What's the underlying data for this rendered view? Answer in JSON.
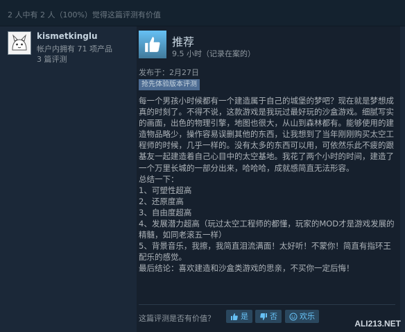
{
  "header": {
    "helpful_count": "2 人中有 2 人（100%）觉得这篇评测有价值"
  },
  "author": {
    "username": "kismetkinglu",
    "owned_products": "帐户内拥有 71 项产品",
    "review_count": "3 篇评测"
  },
  "review": {
    "verdict": "推荐",
    "hours": "9.5 小时（记录在案的）",
    "posted": "发布于：2月27日",
    "early_access": "抢先体验版本评测",
    "paragraphs": [
      "每一个男孩小时候都有一个建造属于自己的城堡的梦吧？现在就是梦想成真的时刻了。不得不说，这款游戏是我玩过最好玩的沙盒游戏。细腻写实的画面，出色的物理引擎，地图也很大，从山到森林都有。能够使用的建造物品略少，操作容易误删其他的东西，让我想到了当年刚刚购买太空工程师的时候，几乎一样的。没有太多的东西可以用，可依然乐此不疲的跟基友一起建造着自己心目中的太空基地。我花了两个小时的时间，建造了一个万里长城的一部分出来，哈哈哈，成就感简直无法形容。",
      "总结一下：",
      "1、可塑性超高",
      "2、还原度高",
      "3、自由度超高",
      "4、发展潜力超高（玩过太空工程师的都懂，玩家的MOD才是游戏发展的精髓，如同老滚五一样）",
      "5、背景音乐，我擦，我简直泪流满面！太好听！不蒙你！简直有指环王配乐的感觉。",
      "最后结论：喜欢建造和沙盒类游戏的思亲，不买你一定后悔！"
    ]
  },
  "vote": {
    "question": "这篇评测是否有价值？",
    "yes_label": "是",
    "no_label": "否",
    "funny_label": "欢乐"
  },
  "watermark": "ALI213.NET",
  "colors": {
    "background": "#1b2838",
    "accent": "#66c0f4",
    "badge": "#4c6b92"
  },
  "icons": {
    "verdict": "thumbs-up-icon",
    "yes": "thumbs-up-icon",
    "no": "thumbs-down-icon",
    "funny": "smiley-icon"
  }
}
